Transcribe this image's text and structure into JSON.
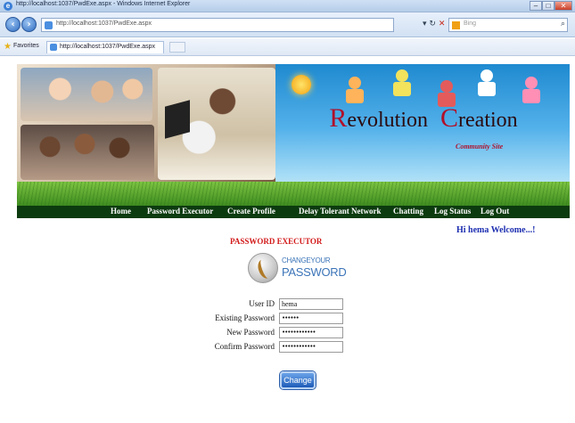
{
  "browser": {
    "window_title": "http://localhost:1037/PwdExe.aspx - Windows Internet Explorer",
    "address_url": "http://localhost:1037/PwdExe.aspx",
    "search_placeholder": "Bing",
    "favorites_label": "Favorites",
    "tab_title": "http://localhost:1037/PwdExe.aspx",
    "window_controls": [
      "minimize-icon",
      "maximize-icon",
      "close-icon"
    ]
  },
  "site": {
    "logo_r": "R",
    "logo_r_rest": "evolution",
    "logo_c": "C",
    "logo_c_rest": "reation",
    "tagline": "Community Site"
  },
  "menu": {
    "items": [
      {
        "label": "Home"
      },
      {
        "label": "Password Executor"
      },
      {
        "label": "Create Profile"
      },
      {
        "label": "Delay Tolerant Network"
      },
      {
        "label": "Chatting"
      },
      {
        "label": "Log Status"
      },
      {
        "label": "Log Out"
      }
    ]
  },
  "welcome_text": "Hi hema Welcome...!",
  "heading": "PASSWORD EXECUTOR",
  "change_password_logo": {
    "line1": "CHANGEYOUR",
    "line2": "PASSWORD"
  },
  "form": {
    "user_id_label": "User ID",
    "user_id_value": "hema",
    "existing_password_label": "Existing Password",
    "existing_password_value": "••••••",
    "new_password_label": "New Password",
    "new_password_value": "••••••••••••",
    "confirm_password_label": "Confirm Password",
    "confirm_password_value": "••••••••••••",
    "change_button": "Change"
  },
  "colors": {
    "menu_bar": "#0c3b0f",
    "heading": "#d21a1a",
    "welcome": "#1d2fb0",
    "logo_accent": "#b0102a"
  }
}
